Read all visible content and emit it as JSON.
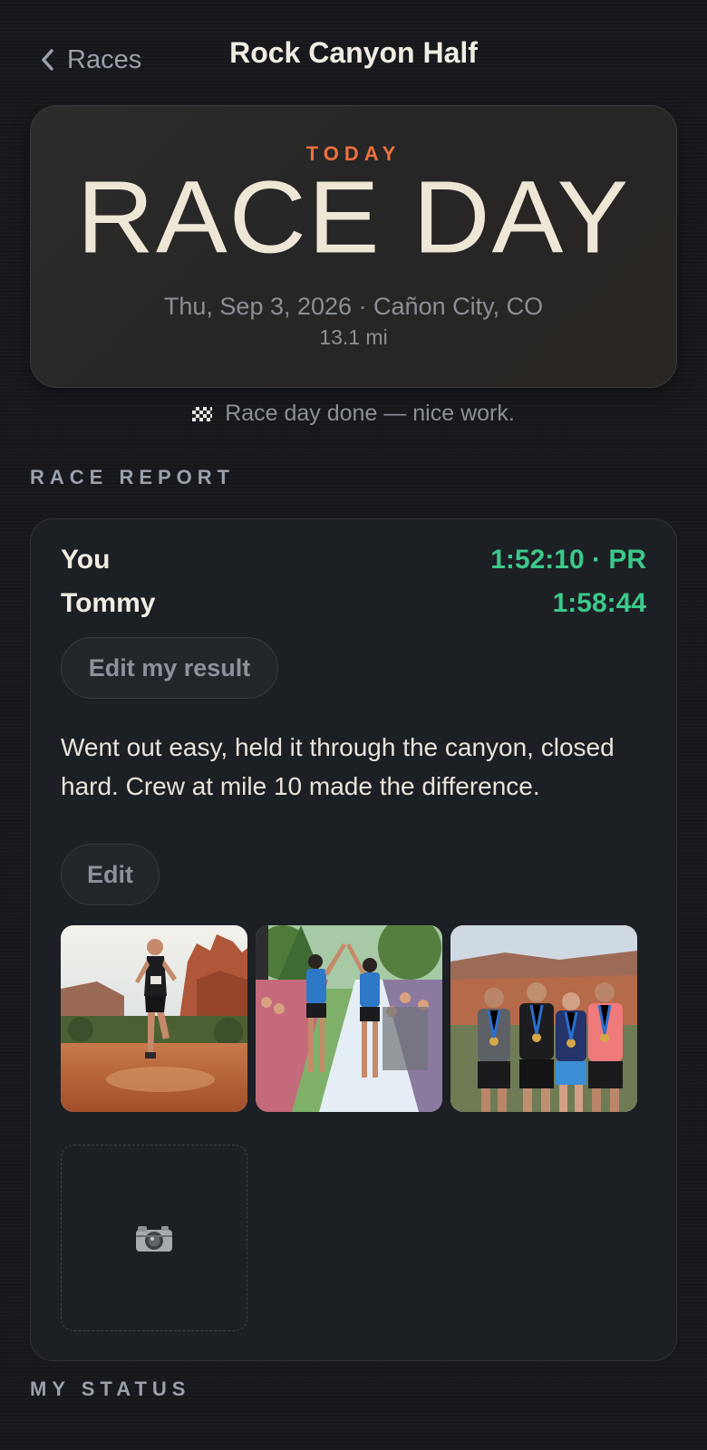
{
  "nav": {
    "back_label": "Races",
    "title": "Rock Canyon Half"
  },
  "hero": {
    "eyebrow": "TODAY",
    "headline": "RACE DAY",
    "date_location": "Thu, Sep 3, 2026 · Cañon City, CO",
    "distance": "13.1 mi"
  },
  "status_message": "Race day done — nice work.",
  "race_report": {
    "section_title": "RACE REPORT",
    "results": [
      {
        "name": "You",
        "time": "1:52:10 · PR"
      },
      {
        "name": "Tommy",
        "time": "1:58:44"
      }
    ],
    "edit_result_label": "Edit my result",
    "notes": "Went out easy, held it through the canyon, closed hard. Crew at mile 10 made the difference.",
    "edit_notes_label": "Edit",
    "photos": [
      "runner-in-canyon-photo",
      "high-five-finish-photo",
      "group-medal-photo"
    ],
    "add_photo_icon": "camera-icon"
  },
  "my_status": {
    "section_title": "MY STATUS"
  },
  "colors": {
    "accent_orange": "#ee6f3e",
    "time_green": "#3cc98a",
    "background": "#16181c"
  }
}
